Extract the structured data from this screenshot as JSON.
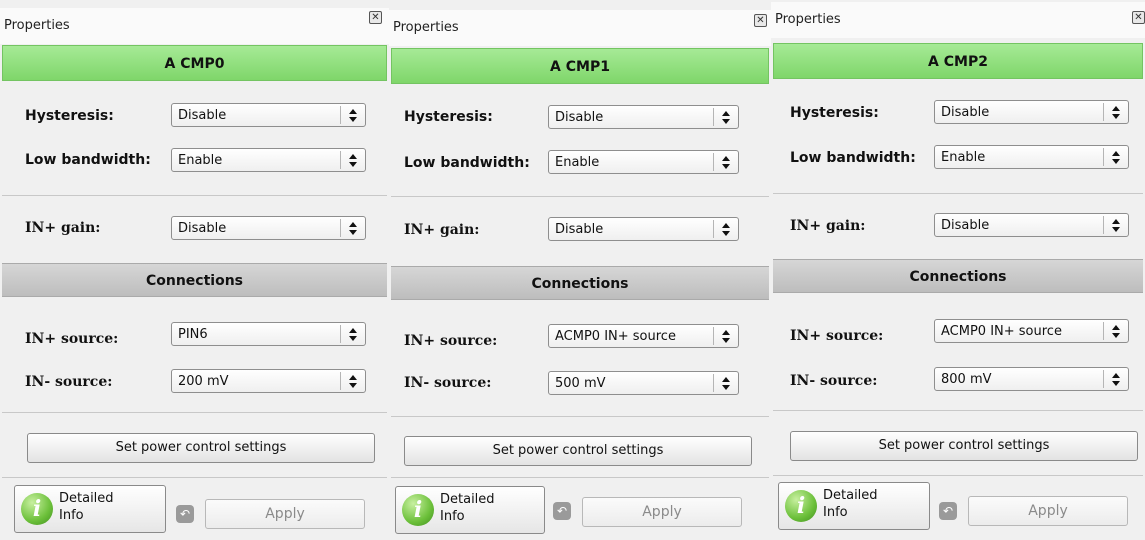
{
  "panels": [
    {
      "title": "Properties",
      "header": "A CMP0",
      "hysteresis_label": "Hysteresis:",
      "hysteresis_value": "Disable",
      "low_bandwidth_label": "Low bandwidth:",
      "low_bandwidth_value": "Enable",
      "in_gain_label": "IN+ gain:",
      "in_gain_value": "Disable",
      "connections_label": "Connections",
      "in_plus_source_label": "IN+ source:",
      "in_plus_source_value": "PIN6",
      "in_minus_source_label": "IN- source:",
      "in_minus_source_value": "200 mV",
      "power_button": "Set power control settings",
      "detailed_info_line1": "Detailed",
      "detailed_info_line2": "Info",
      "apply": "Apply"
    },
    {
      "title": "Properties",
      "header": "A CMP1",
      "hysteresis_label": "Hysteresis:",
      "hysteresis_value": "Disable",
      "low_bandwidth_label": "Low bandwidth:",
      "low_bandwidth_value": "Enable",
      "in_gain_label": "IN+ gain:",
      "in_gain_value": "Disable",
      "connections_label": "Connections",
      "in_plus_source_label": "IN+ source:",
      "in_plus_source_value": "ACMP0 IN+ source",
      "in_minus_source_label": "IN- source:",
      "in_minus_source_value": "500 mV",
      "power_button": "Set power control settings",
      "detailed_info_line1": "Detailed",
      "detailed_info_line2": "Info",
      "apply": "Apply"
    },
    {
      "title": "Properties",
      "header": "A CMP2",
      "hysteresis_label": "Hysteresis:",
      "hysteresis_value": "Disable",
      "low_bandwidth_label": "Low bandwidth:",
      "low_bandwidth_value": "Enable",
      "in_gain_label": "IN+ gain:",
      "in_gain_value": "Disable",
      "connections_label": "Connections",
      "in_plus_source_label": "IN+ source:",
      "in_plus_source_value": "ACMP0 IN+ source",
      "in_minus_source_label": "IN- source:",
      "in_minus_source_value": "800 mV",
      "power_button": "Set power control settings",
      "detailed_info_line1": "Detailed",
      "detailed_info_line2": "Info",
      "apply": "Apply"
    }
  ],
  "icons": {
    "close": "close-icon",
    "info": "info-icon",
    "undo": "undo-icon",
    "spinner": "up-down-arrows-icon"
  },
  "colors": {
    "header_green": "#8edc7a",
    "section_gray": "#c9c9c9",
    "panel_bg": "#f0f0f0"
  }
}
